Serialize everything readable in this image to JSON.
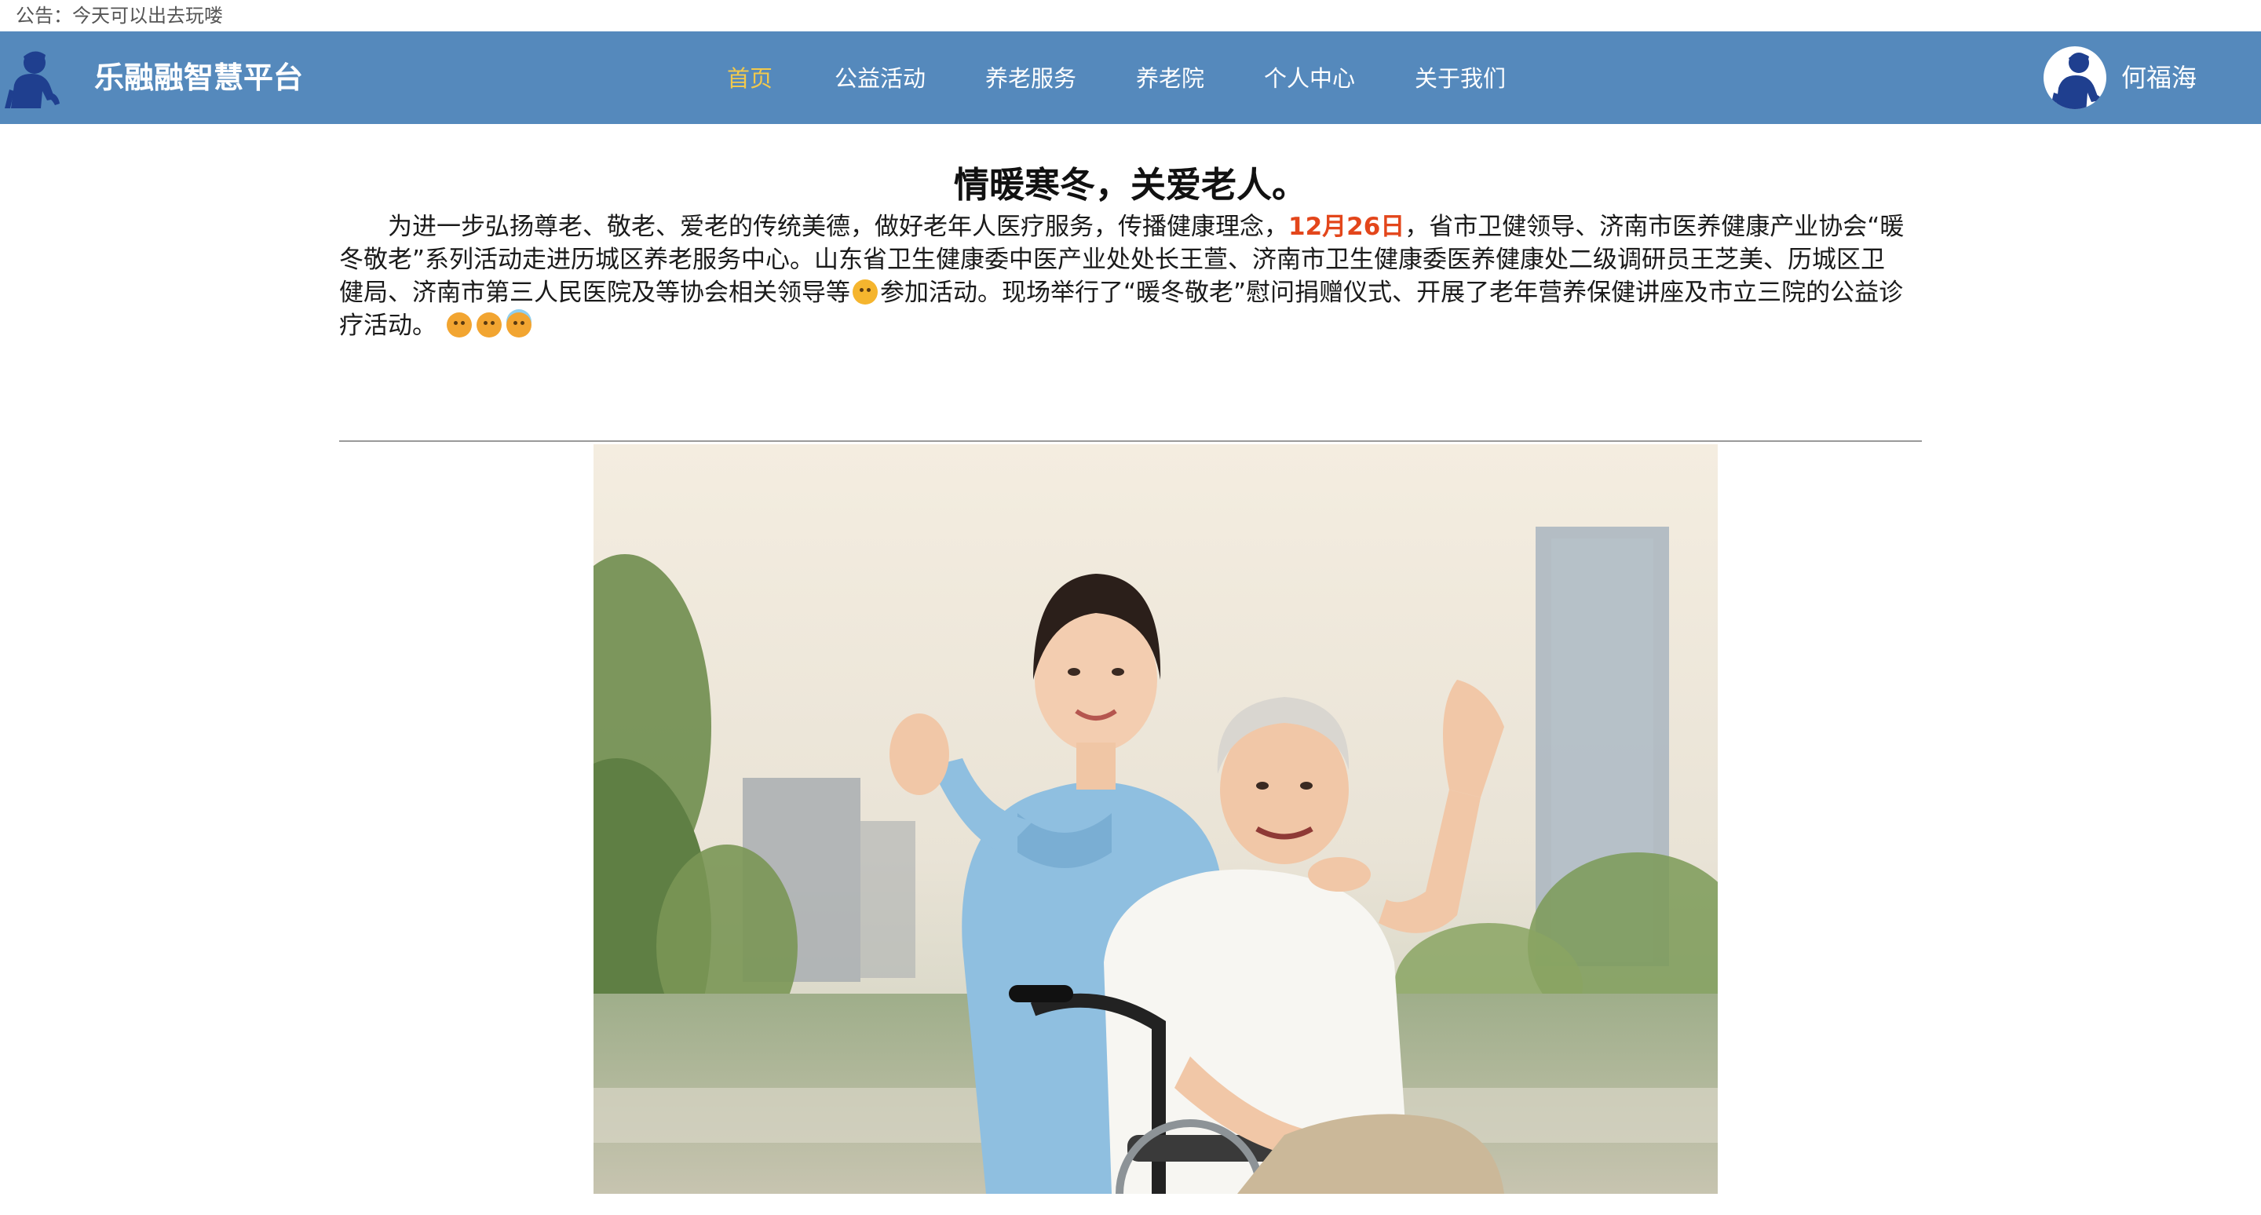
{
  "notice": {
    "text": "公告：今天可以出去玩喽"
  },
  "header": {
    "brand_name": "乐融融智慧平台",
    "nav_items": [
      {
        "label": "首页",
        "active": true
      },
      {
        "label": "公益活动",
        "active": false
      },
      {
        "label": "养老服务",
        "active": false
      },
      {
        "label": "养老院",
        "active": false
      },
      {
        "label": "个人中心",
        "active": false
      },
      {
        "label": "关于我们",
        "active": false
      }
    ],
    "user_name": "何福海"
  },
  "article": {
    "title": "情暖寒冬，关爱老人。",
    "body_part1": "为进一步弘扬尊老、敬老、爱老的传统美德，做好老年人医疗服务，传播健康理念，",
    "highlight": "12月26日",
    "body_part2": "，省市卫健领导、济南市医养健康产业协会“暖冬敬老”系列活动走进历城区养老服务中心。山东省卫生健康委中医产业处处长王萱、济南市卫生健康委医养健康处二级调研员王芝美、历城区卫健局、济南市第三人民医院及等协会相关领导等",
    "body_part3": "参加活动。现场举行了“暖冬敬老”慰问捐赠仪式、开展了老年营养保健讲座及市立三院的公益诊疗活动。"
  },
  "colors": {
    "navbar": "#5589bc",
    "active_nav": "#f2c94c",
    "highlight": "#e3461b"
  },
  "icons": {
    "brand": "elderly-person-icon",
    "user": "user-avatar-icon"
  }
}
